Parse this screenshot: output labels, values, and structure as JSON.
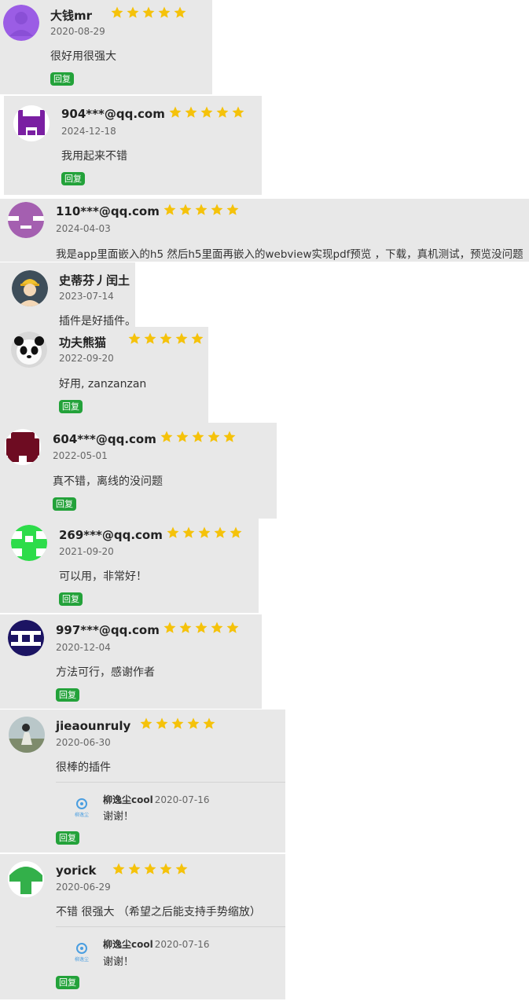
{
  "reviews": [
    {
      "user": "大钱mr",
      "date": "2020-08-29",
      "content": "很好用很强大",
      "reply_label": "回复",
      "avatar_icon": "purple-default-avatar",
      "rating": 5
    },
    {
      "user": "904***@qq.com",
      "date": "2024-12-18",
      "content": "我用起来不错",
      "reply_label": "回复",
      "avatar_icon": "purple-identicon-avatar",
      "rating": 5
    },
    {
      "user": "110***@qq.com",
      "date": "2024-04-03",
      "content": "我是app里面嵌入的h5 然后h5里面再嵌入的webview实现pdf预览 ，下载，真机测试，预览没问题",
      "reply_label": "回复",
      "avatar_icon": "violet-identicon-avatar",
      "rating": 5
    },
    {
      "user": "史蒂芬丿闰土",
      "date": "2023-07-14",
      "content": "插件是好插件。",
      "avatar_icon": "worker-helmet-avatar"
    },
    {
      "user": "功夫熊猫",
      "date": "2022-09-20",
      "content": "好用, zanzanzan",
      "reply_label": "回复",
      "avatar_icon": "panda-avatar",
      "rating": 5
    },
    {
      "user": "604***@qq.com",
      "date": "2022-05-01",
      "content": "真不错，离线的没问题",
      "reply_label": "回复",
      "avatar_icon": "maroon-identicon-avatar",
      "rating": 5
    },
    {
      "user": "269***@qq.com",
      "date": "2021-09-20",
      "content": "可以用，非常好！",
      "reply_label": "回复",
      "avatar_icon": "green-identicon-avatar",
      "rating": 5
    },
    {
      "user": "997***@qq.com",
      "date": "2020-12-04",
      "content": "方法可行，感谢作者",
      "reply_label": "回复",
      "avatar_icon": "navy-identicon-avatar",
      "rating": 5
    },
    {
      "user": "jieaounruly",
      "date": "2020-06-30",
      "content": "很棒的插件",
      "reply_label": "回复",
      "avatar_icon": "photo-avatar",
      "rating": 5,
      "author_reply": {
        "name": "柳逸尘cool",
        "date": "2020-07-16",
        "text": "谢谢！",
        "logo_icon": "author-logo-icon",
        "logo_text": "柳逸尘"
      }
    },
    {
      "user": "yorick",
      "date": "2020-06-29",
      "content": "不错 很强大 （希望之后能支持手势缩放）",
      "reply_label": "回复",
      "avatar_icon": "green-mushroom-identicon-avatar",
      "rating": 5,
      "author_reply": {
        "name": "柳逸尘cool",
        "date": "2020-07-16",
        "text": "谢谢！",
        "logo_icon": "author-logo-icon",
        "logo_text": "柳逸尘"
      }
    }
  ],
  "colors": {
    "star": "#f5c20a",
    "reply_button": "#23a23a",
    "card_bg": "#e8e8e8"
  }
}
